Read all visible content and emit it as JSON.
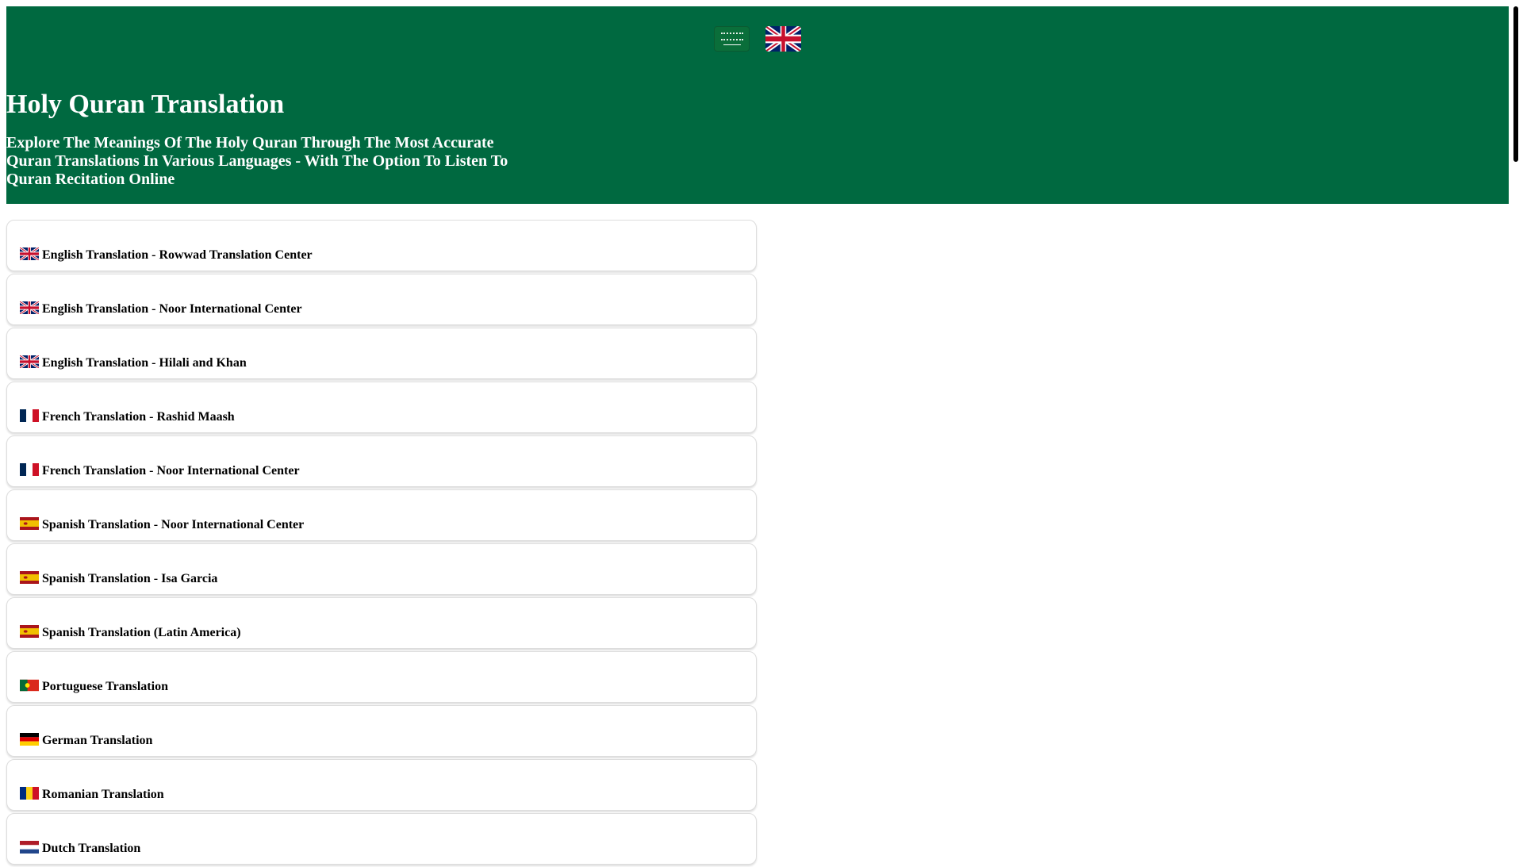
{
  "header": {
    "languages": [
      {
        "name": "Arabic",
        "icon": "saudi-flag-icon"
      },
      {
        "name": "English",
        "icon": "uk-flag-icon"
      }
    ],
    "title": "Holy Quran Translation",
    "subtitle": "Explore The Meanings Of The Holy Quran Through The Most Accurate Quran Translations In Various Languages - With The Option To Listen To Quran Recitation Online",
    "background_color": "#006940"
  },
  "translations": [
    {
      "label": "English Translation - Rowwad Translation Center",
      "flag": "uk"
    },
    {
      "label": "English Translation - Noor International Center",
      "flag": "uk"
    },
    {
      "label": "English Translation - Hilali and Khan",
      "flag": "uk"
    },
    {
      "label": "French Translation - Rashid Maash",
      "flag": "fr"
    },
    {
      "label": "French Translation - Noor International Center",
      "flag": "fr"
    },
    {
      "label": "Spanish Translation - Noor International Center",
      "flag": "es"
    },
    {
      "label": "Spanish Translation - Isa Garcia",
      "flag": "es"
    },
    {
      "label": "Spanish Translation (Latin America)",
      "flag": "es"
    },
    {
      "label": "Portuguese Translation",
      "flag": "pt"
    },
    {
      "label": "German Translation",
      "flag": "de"
    },
    {
      "label": "Romanian Translation",
      "flag": "ro"
    },
    {
      "label": "Dutch Translation",
      "flag": "nl"
    }
  ]
}
